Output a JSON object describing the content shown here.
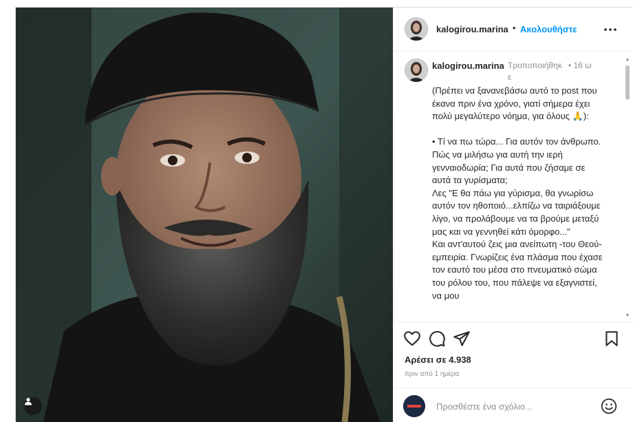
{
  "post": {
    "username": "kalogirou.marina",
    "follow_label": "Ακολουθήστε",
    "dot_separator": "•",
    "caption": {
      "username": "kalogirou.marina",
      "edited_label": "Τροποποιήθηκε",
      "time_label": "• 16 ω",
      "text": "(Πρέπει να ξανανεβάσω αυτό το post που έκανα πριν ένα χρόνο, γιατί σήμερα έχει πολύ μεγαλύτερο νόημα, για όλους 🙏):\n\n• Τί να πω τώρα... Για αυτόν τον άνθρωπο. Πώς να μιλήσω για αυτή την ιερή γενναιοδωρία; Για αυτά που ζήσαμε σε αυτά τα γυρίσματα;\nΛες \"Ε θα πάω για γύρισμα, θα γνωρίσω αυτόν τον ηθοποιό...ελπίζω να ταιριάξουμε λίγο, να προλάβουμε να τα βρούμε μεταξύ μας και να γεννηθεί κάτι όμορφο...\"\nΚαι αντ'αυτού ζεις μια ανείπωτη -του Θεού- εμπειρία. Γνωρίζεις ένα πλάσμα που έχασε τον εαυτό του μέσα στο πνευματικό σώμα του ρόλου του, που πάλεψε να εξαγνιστεί, να μου"
    },
    "likes_text": "Αρέσει σε 4.938",
    "timestamp": "πριν από 1 ημέρα",
    "comment_placeholder": "Προσθέστε ένα σχόλιο..."
  },
  "icons": {
    "more": "more-options-icon",
    "like": "heart-icon",
    "comment": "comment-icon",
    "share": "paper-plane-icon",
    "save": "bookmark-icon",
    "emoji": "smiley-icon",
    "tag": "user-tag-icon"
  },
  "colors": {
    "accent": "#0095f6",
    "text": "#262626",
    "muted": "#8e8e8e",
    "border": "#efefef"
  }
}
